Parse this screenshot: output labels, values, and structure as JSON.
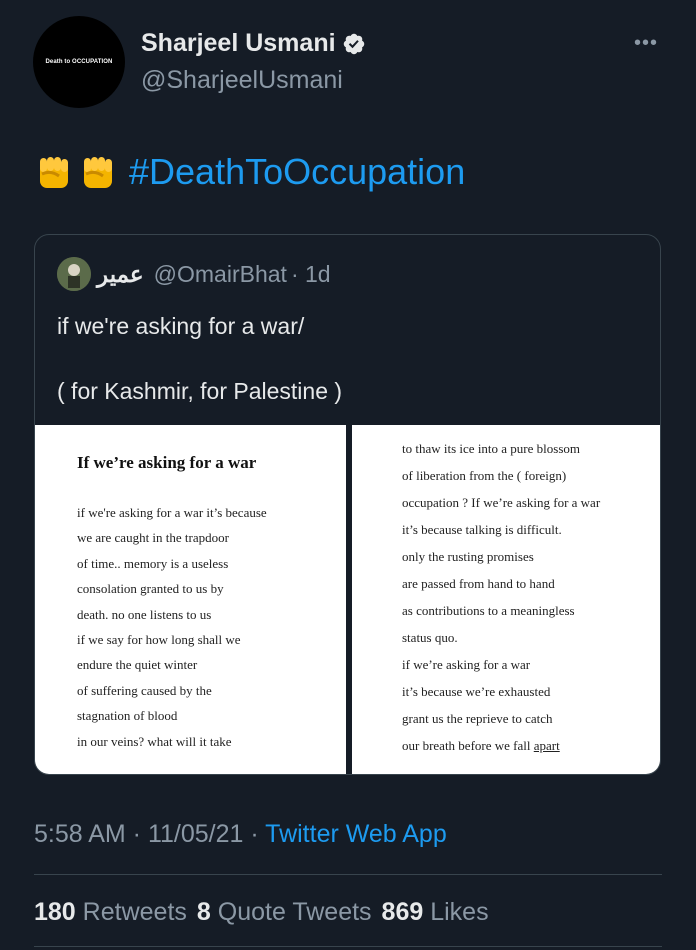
{
  "author": {
    "avatar_text": "Death to OCCUPATION",
    "name": "Sharjeel Usmani",
    "handle": "@SharjeelUsmani",
    "verified": true
  },
  "more_icon": "more-options-icon",
  "tweet": {
    "emoji": [
      "raised-fist",
      "raised-fist"
    ],
    "hashtag": "#DeathToOccupation"
  },
  "quoted": {
    "name": "عمير",
    "handle": "@OmairBhat",
    "time": "· 1d",
    "text_line1": "if we're asking for a war/",
    "text_line2": "( for Kashmir, for Palestine )",
    "poem_title": "If we’re asking for a war",
    "left_lines": [
      "if we're asking for a war it’s because",
      "we are caught in the trapdoor",
      "of time.. memory is a useless",
      "consolation granted to us by",
      " death. no one listens to us",
      "if we say for how long shall we",
      "endure the quiet winter",
      "of suffering caused by the",
      "stagnation of blood",
      "in our veins? what will it take"
    ],
    "right_lines": [
      "to thaw its ice into a pure blossom",
      "of liberation from the ( foreign)",
      "occupation ? If we’re asking for a war",
      "it’s because talking is difficult.",
      "only the rusting promises",
      "are passed from hand to hand",
      "as contributions to a meaningless",
      "status quo.",
      "if we’re asking for a war",
      "it’s because we’re exhausted",
      "grant us the reprieve to catch",
      "our breath before we fall ",
      "apart"
    ]
  },
  "meta": {
    "time": "5:58 AM · 11/05/21 · ",
    "app": "Twitter Web App"
  },
  "stats": {
    "retweets_count": "180",
    "retweets_label": "Retweets",
    "quotes_count": "8",
    "quotes_label": "Quote Tweets",
    "likes_count": "869",
    "likes_label": "Likes"
  },
  "colors": {
    "background": "#151c26",
    "accent": "#1d9bf0",
    "secondary_text": "#8b98a5"
  }
}
